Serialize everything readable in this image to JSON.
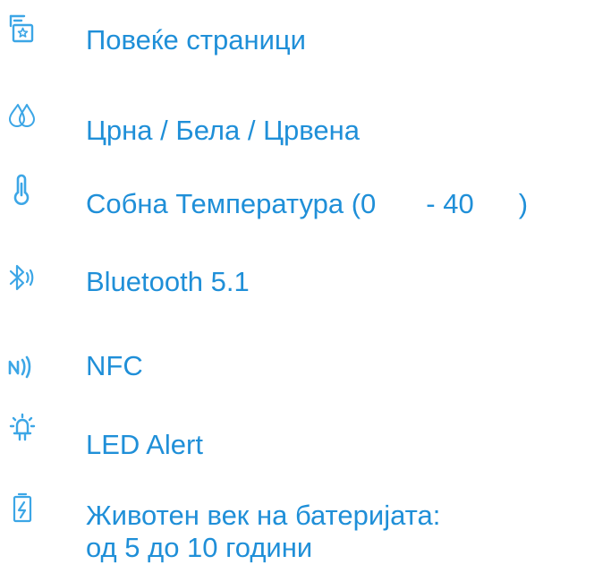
{
  "colors": {
    "text": "#1f8fd8",
    "icon": "#3ca6e6"
  },
  "features": [
    {
      "icon": "multi-page-icon",
      "label": "Повеќе страници"
    },
    {
      "icon": "color-drops-icon",
      "label": "Црна / Бела / Црвена"
    },
    {
      "icon": "thermometer-icon",
      "label_prefix": "Собна Температура (0",
      "label_mid": "- 40",
      "label_suffix": ")"
    },
    {
      "icon": "bluetooth-icon",
      "label": "Bluetooth 5.1"
    },
    {
      "icon": "nfc-icon",
      "label": "NFC"
    },
    {
      "icon": "led-alert-icon",
      "label": "LED Alert"
    },
    {
      "icon": "battery-icon",
      "label_line1": "Животен век на батеријата:",
      "label_line2": "од 5 до 10 години"
    }
  ]
}
